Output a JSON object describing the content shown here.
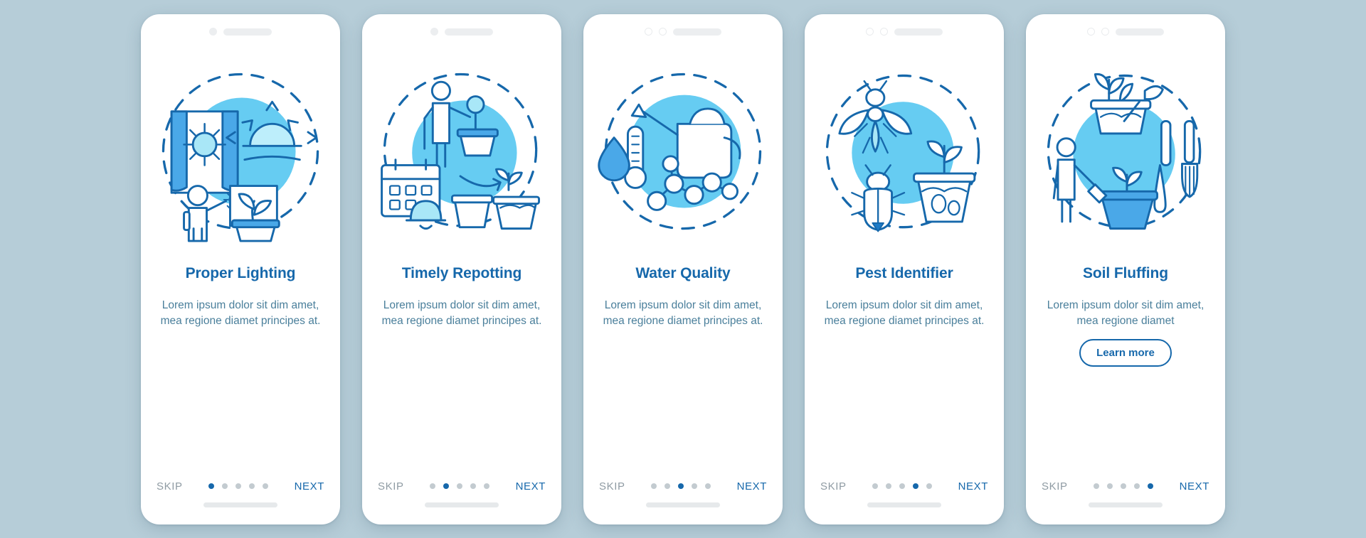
{
  "app": {
    "background_color": "#b6cdd8",
    "accent_color": "#1668ab",
    "body_text_color": "#4a7f9b",
    "skip_color": "#8f9ba3",
    "dot_inactive_color": "#c3cbd0",
    "illustration_circle_color": "#66ccf2"
  },
  "shared": {
    "skip_label": "SKIP",
    "next_label": "NEXT",
    "total_dots": 5
  },
  "screens": [
    {
      "id": "proper-lighting",
      "title": "Proper Lighting",
      "body": "Lorem ipsum dolor sit dim amet, mea regione diamet principes at.",
      "active_dot": 1,
      "skip_label": "SKIP",
      "next_label": "NEXT",
      "has_learn_more": false,
      "learn_more_label": "",
      "notch": [
        "cam-dot",
        "speaker"
      ],
      "illustration": "window-sun-plant-watering-icon"
    },
    {
      "id": "timely-repotting",
      "title": "Timely Repotting",
      "body": "Lorem ipsum dolor sit dim amet, mea regione diamet principes at.",
      "active_dot": 2,
      "skip_label": "SKIP",
      "next_label": "NEXT",
      "has_learn_more": false,
      "learn_more_label": "",
      "notch": [
        "cam-dot",
        "speaker"
      ],
      "illustration": "calendar-repotting-plant-icon"
    },
    {
      "id": "water-quality",
      "title": "Water Quality",
      "body": "Lorem ipsum dolor sit dim amet, mea regione diamet principes at.",
      "active_dot": 3,
      "skip_label": "SKIP",
      "next_label": "NEXT",
      "has_learn_more": false,
      "learn_more_label": "",
      "notch": [
        "cam-ring",
        "cam-ring",
        "speaker"
      ],
      "illustration": "watering-can-thermometer-molecule-icon"
    },
    {
      "id": "pest-identifier",
      "title": "Pest Identifier",
      "body": "Lorem ipsum dolor sit dim amet, mea regione diamet principes at.",
      "active_dot": 4,
      "skip_label": "SKIP",
      "next_label": "NEXT",
      "has_learn_more": false,
      "learn_more_label": "",
      "notch": [
        "cam-ring",
        "cam-ring",
        "speaker"
      ],
      "illustration": "fly-beetle-pot-pest-icon"
    },
    {
      "id": "soil-fluffing",
      "title": "Soil Fluffing",
      "body": "Lorem ipsum dolor sit dim amet, mea regione diamet",
      "active_dot": 5,
      "skip_label": "SKIP",
      "next_label": "NEXT",
      "has_learn_more": true,
      "learn_more_label": "Learn more",
      "notch": [
        "cam-ring",
        "cam-ring",
        "speaker"
      ],
      "illustration": "gardening-tools-soil-icon"
    }
  ]
}
